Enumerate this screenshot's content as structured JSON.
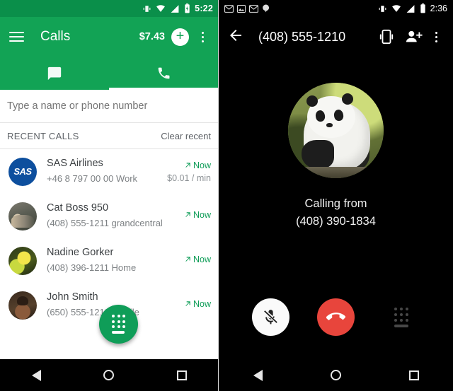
{
  "left_phone": {
    "statusbar": {
      "time": "5:22",
      "icons": [
        "vibrate-icon",
        "wifi-icon",
        "cell-signal-icon",
        "battery-icon"
      ]
    },
    "appbar": {
      "menu_icon": "hamburger-menu-icon",
      "title": "Calls",
      "credit": "$7.43",
      "add_icon": "plus-icon",
      "overflow_icon": "more-vert-icon"
    },
    "tabs": [
      {
        "label": "Messages",
        "icon": "chat-bubble-icon",
        "active": false
      },
      {
        "label": "Calls",
        "icon": "phone-icon",
        "active": true
      }
    ],
    "search": {
      "placeholder": "Type a name or phone number",
      "value": ""
    },
    "recent": {
      "section_label": "RECENT CALLS",
      "clear_label": "Clear recent"
    },
    "calls": [
      {
        "avatar": "sas-logo-avatar",
        "avatar_text": "SAS",
        "name": "SAS Airlines",
        "subtitle": "+46 8 797 00 00 Work",
        "when": "Now",
        "direction_icon": "outgoing-call-arrow-icon",
        "rate": "$0.01 / min"
      },
      {
        "avatar": "cat-photo-avatar",
        "avatar_text": "",
        "name": "Cat Boss 950",
        "subtitle": "(408) 555-1211 grandcentral",
        "when": "Now",
        "direction_icon": "outgoing-call-arrow-icon",
        "rate": ""
      },
      {
        "avatar": "nadine-photo-avatar",
        "avatar_text": "",
        "name": "Nadine Gorker",
        "subtitle": "(408) 396-1211 Home",
        "when": "Now",
        "direction_icon": "outgoing-call-arrow-icon",
        "rate": ""
      },
      {
        "avatar": "john-photo-avatar",
        "avatar_text": "",
        "name": "John Smith",
        "subtitle": "(650) 555-1212 Mobile",
        "when": "Now",
        "direction_icon": "outgoing-call-arrow-icon",
        "rate": ""
      }
    ],
    "fab": {
      "icon": "dialpad-icon",
      "label": ""
    },
    "navbar": [
      "back-nav-icon",
      "home-nav-icon",
      "recents-nav-icon"
    ],
    "colors": {
      "accent": "#12a355",
      "statusbar": "#0a8f4a",
      "fab": "#0f9d58",
      "now_text": "#0f9d58"
    }
  },
  "right_phone": {
    "statusbar": {
      "time": "2:36",
      "left_icons": [
        "gmail-icon",
        "gallery-icon",
        "gmail-icon",
        "hangouts-icon"
      ],
      "right_icons": [
        "vibrate-icon",
        "wifi-icon",
        "cell-signal-icon",
        "battery-icon"
      ]
    },
    "appbar": {
      "back_icon": "back-arrow-icon",
      "number": "(408) 555-1210",
      "device_icon": "phone-link-icon",
      "add_contact_icon": "add-person-icon",
      "overflow_icon": "more-vert-icon"
    },
    "contact_photo": "panda-photo",
    "status": {
      "line1": "Calling from",
      "line2": "(408) 390-1834"
    },
    "actions": [
      {
        "name": "mute-button",
        "icon": "microphone-muted-icon",
        "color": "#fafafa"
      },
      {
        "name": "end-call-button",
        "icon": "hangup-phone-icon",
        "color": "#e8453c"
      },
      {
        "name": "keypad-button",
        "icon": "dialpad-icon",
        "color": "#000000"
      }
    ],
    "navbar": [
      "back-nav-icon",
      "home-nav-icon",
      "recents-nav-icon"
    ],
    "colors": {
      "background": "#000000",
      "end_call": "#e8453c",
      "mute": "#fafafa"
    }
  }
}
